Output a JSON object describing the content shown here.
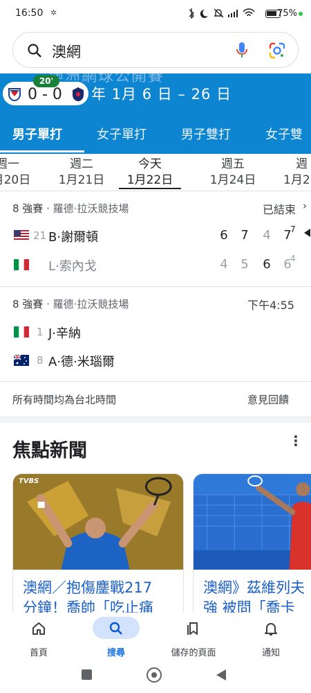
{
  "status_bar": {
    "time": "16:50",
    "battery": "75%"
  },
  "search": {
    "query": "澳網"
  },
  "header": {
    "ghost_text": "澳洲網球公開賽",
    "date_range": "年 1月 6 日 – 26 日",
    "live_badge": "20'",
    "live_score": "0 - 0",
    "tabs": [
      "男子單打",
      "女子單打",
      "男子雙打",
      "女子雙"
    ]
  },
  "days": [
    {
      "top": "週一",
      "bottom": "1月20日"
    },
    {
      "top": "週二",
      "bottom": "1月21日"
    },
    {
      "top": "今天",
      "bottom": "1月22日"
    },
    {
      "top": "週五",
      "bottom": "1月24日"
    },
    {
      "top": "週",
      "bottom": "1月2"
    }
  ],
  "matches": [
    {
      "round": "8 強賽",
      "venue": "羅德·拉沃競技場",
      "status": "已結束",
      "players": [
        {
          "seed": "21",
          "name": "B·謝爾頓",
          "sets": [
            "6",
            "7",
            "4",
            "7"
          ],
          "tiebreak": "7",
          "winner": true,
          "flag": "usa"
        },
        {
          "seed": "",
          "name": "L·索內戈",
          "sets": [
            "4",
            "5",
            "6",
            "6"
          ],
          "tiebreak": "4",
          "winner": false,
          "flag": "italy"
        }
      ]
    },
    {
      "round": "8 強賽",
      "venue": "羅德·拉沃競技場",
      "status": "下午4:55",
      "players": [
        {
          "seed": "1",
          "name": "J·辛納",
          "flag": "italy"
        },
        {
          "seed": "8",
          "name": "A·德·米瑙爾",
          "flag": "australia"
        }
      ]
    }
  ],
  "footer": {
    "timezone_note": "所有時間均為台北時間",
    "feedback": "意見回饋"
  },
  "news": {
    "title": "焦點新聞",
    "cards": [
      {
        "line1": "澳網／抱傷鏖戰217",
        "line2": "分鐘！喬帥「吃止痛",
        "source_logo": "TVBS"
      },
      {
        "line1": "澳網》茲維列夫",
        "line2": "強 被問「喬卡"
      }
    ]
  },
  "bottom_nav": [
    {
      "label": "首頁",
      "icon": "home-icon"
    },
    {
      "label": "搜尋",
      "icon": "search-icon",
      "active": true
    },
    {
      "label": "儲存的頁面",
      "icon": "bookmark-icon"
    },
    {
      "label": "通知",
      "icon": "bell-icon"
    }
  ],
  "colors": {
    "header_blue": "#0e85d1",
    "link_blue": "#1a5fc8",
    "active_nav": "#1a73e8",
    "live_green": "#188038"
  }
}
